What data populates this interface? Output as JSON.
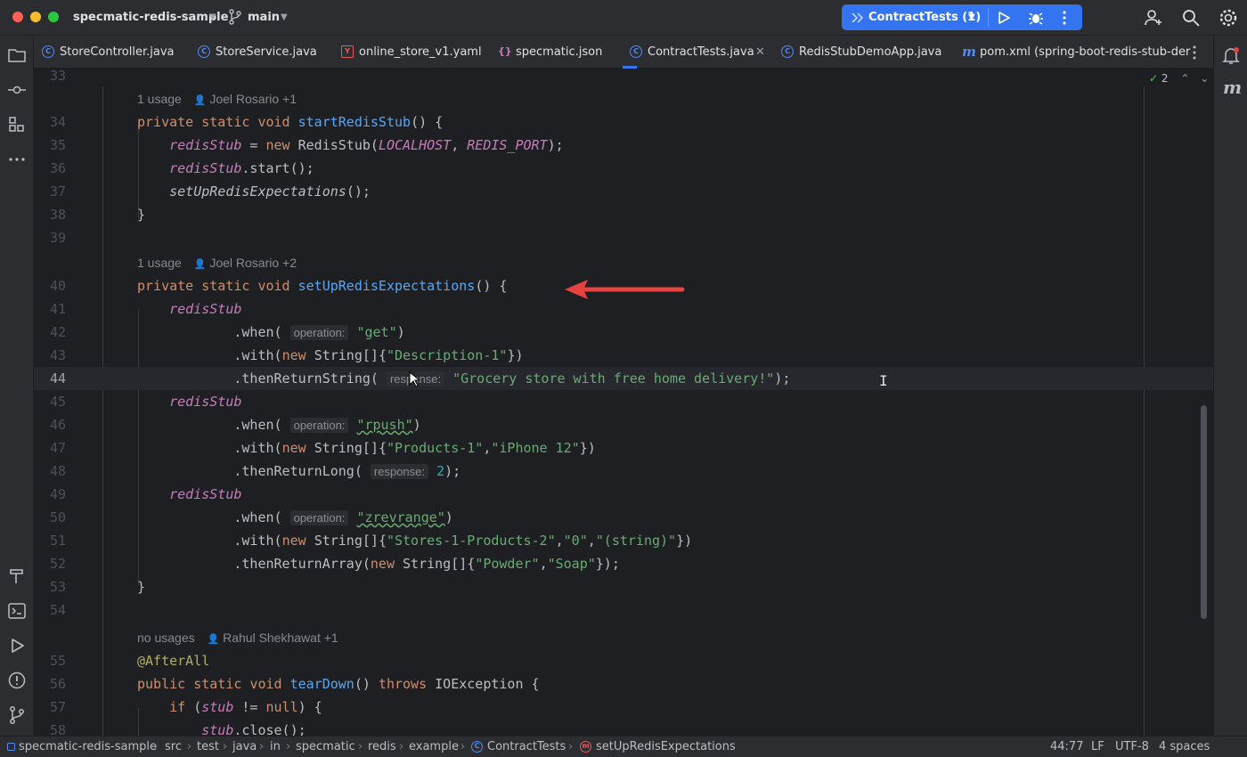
{
  "window": {
    "project": "specmatic-redis-sample",
    "branch": "main",
    "run_config": "ContractTests (1)"
  },
  "colors": {
    "accent": "#3574f0",
    "arrow": "#e8423f",
    "keyword": "#cf8e6d",
    "function": "#56a8f5",
    "string": "#6aab73",
    "field": "#c77dbb"
  },
  "tabs": [
    {
      "label": "StoreController.java",
      "icon": "java-class-icon"
    },
    {
      "label": "StoreService.java",
      "icon": "java-class-icon"
    },
    {
      "label": "online_store_v1.yaml",
      "icon": "yaml-icon"
    },
    {
      "label": "specmatic.json",
      "icon": "json-icon"
    },
    {
      "label": "ContractTests.java",
      "icon": "java-class-icon",
      "active": true
    },
    {
      "label": "RedisStubDemoApp.java",
      "icon": "java-class-icon"
    },
    {
      "label": "pom.xml (spring-boot-redis-stub-der",
      "icon": "maven-icon"
    }
  ],
  "inspections": {
    "count": "2"
  },
  "editor": {
    "hints": {
      "h1_usage": "1 usage",
      "h1_author": "Joel Rosario +1",
      "h2_usage": "1 usage",
      "h2_author": "Joel Rosario +2",
      "h3_usage": "no usages",
      "h3_author": "Rahul Shekhawat +1"
    },
    "line_numbers": [
      "33",
      "34",
      "35",
      "36",
      "37",
      "38",
      "39",
      "40",
      "41",
      "42",
      "43",
      "44",
      "45",
      "46",
      "47",
      "48",
      "49",
      "50",
      "51",
      "52",
      "53",
      "54",
      "55",
      "56",
      "57",
      "58"
    ],
    "tokens": {
      "private": "private",
      "public": "public",
      "static": "static",
      "void": "void",
      "new": "new",
      "throws": "throws",
      "if": "if",
      "null": "null",
      "startRedisStub": "startRedisStub",
      "setUpRedisExpectations": "setUpRedisExpectations",
      "tearDown": "tearDown",
      "redisStub": "redisStub",
      "RedisStub": "RedisStub",
      "LOCALHOST": "LOCALHOST",
      "REDIS_PORT": "REDIS_PORT",
      "start": ".start();",
      "when": ".when(",
      "with": ".with(",
      "String": "String[]",
      "thenReturnString": ".thenReturnString(",
      "thenReturnLong": ".thenReturnLong(",
      "thenReturnArray": ".thenReturnArray(",
      "afterAll": "@AfterAll",
      "IOException": "IOException",
      "stub": "stub",
      "stubClose": "stub",
      "close": ".close();",
      "op_hint": "operation:",
      "resp_hint": "response:",
      "resp_hint_partial": "response:",
      "s_get": "\"get\"",
      "s_desc1": "\"Description-1\"",
      "s_grocery": "\"Grocery store with free home delivery!\"",
      "s_rpush": "\"rpush\"",
      "s_products1": "\"Products-1\"",
      "s_iphone": "\"iPhone 12\"",
      "n_2": "2",
      "s_zrevrange": "\"zrevrange\"",
      "s_stores": "\"Stores-1-Products-2\"",
      "s_zero": "\"0\"",
      "s_string": "\"(string)\"",
      "s_powder": "\"Powder\"",
      "s_soap": "\"Soap\""
    }
  },
  "breadcrumb": [
    "specmatic-redis-sample",
    "src",
    "test",
    "java",
    "in",
    "specmatic",
    "redis",
    "example",
    "ContractTests",
    "setUpRedisExpectations"
  ],
  "status": {
    "position": "44:77",
    "line_sep": "LF",
    "encoding": "UTF-8",
    "indent": "4 spaces"
  }
}
